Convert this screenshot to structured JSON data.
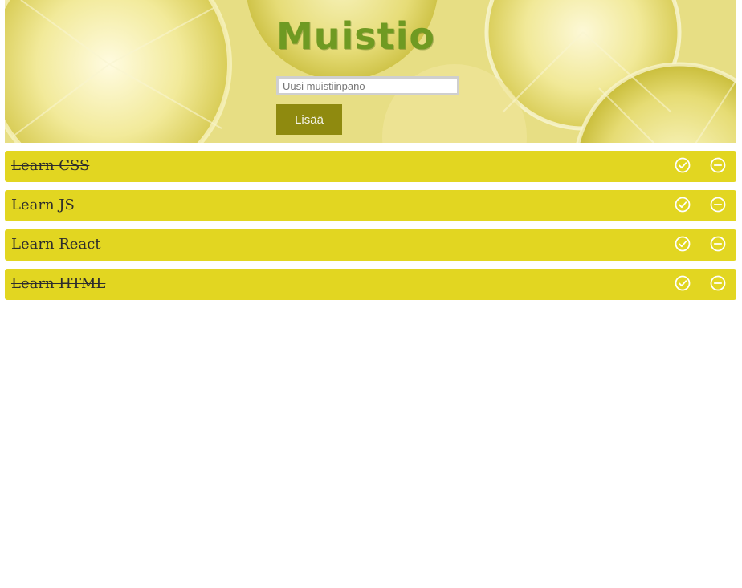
{
  "header": {
    "title": "Muistio",
    "new_note": {
      "value": "",
      "placeholder": "Uusi muistiinpano"
    },
    "add_button_label": "Lisää",
    "background_image": "lemon-slices"
  },
  "todos": [
    {
      "text": "Learn CSS",
      "done": true
    },
    {
      "text": "Learn JS",
      "done": true
    },
    {
      "text": "Learn React",
      "done": false
    },
    {
      "text": "Learn HTML",
      "done": true
    }
  ],
  "icons": {
    "done": "check-circle-icon",
    "remove": "minus-circle-icon"
  },
  "colors": {
    "title": "#6f9a22",
    "item_background": "#e2d621",
    "button_background": "#8f8a0f",
    "icon_stroke": "#ffffff"
  }
}
